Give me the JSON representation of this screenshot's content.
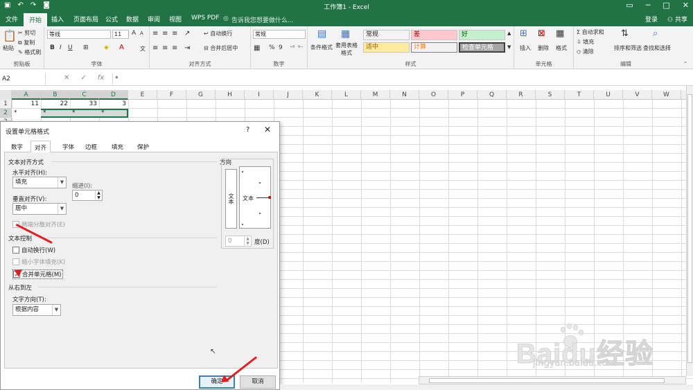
{
  "titlebar": {
    "title": "工作簿1 - Excel",
    "undo_icon": "undo-icon",
    "redo_icon": "redo-icon",
    "camera_icon": "camera-icon"
  },
  "tabs": [
    {
      "label": "文件"
    },
    {
      "label": "开始"
    },
    {
      "label": "插入"
    },
    {
      "label": "页面布局"
    },
    {
      "label": "公式"
    },
    {
      "label": "数据"
    },
    {
      "label": "审阅"
    },
    {
      "label": "视图"
    },
    {
      "label": "WPS PDF"
    }
  ],
  "search_hint": "告诉我您想要做什么...",
  "account": {
    "login": "登录",
    "share": "共享"
  },
  "ribbon": {
    "clipboard": {
      "paste": "粘贴",
      "cut": "剪切",
      "copy": "复制",
      "format_painter": "格式刷",
      "label": "剪贴板"
    },
    "font": {
      "name": "等线",
      "size": "11",
      "label": "字体",
      "bold": "B",
      "italic": "I",
      "underline": "U",
      "grow": "A",
      "shrink": "A"
    },
    "alignment": {
      "wrap": "自动换行",
      "merge": "合并后居中",
      "label": "对齐方式"
    },
    "number": {
      "format": "常规",
      "label": "数字",
      "percent": "%",
      "comma": "9"
    },
    "styles": {
      "conditional": "条件格式",
      "table": "套用表格格式",
      "cells": [
        {
          "label": "常规",
          "color": "#ffffff"
        },
        {
          "label": "差",
          "color": "#ffc7ce"
        },
        {
          "label": "好",
          "color": "#c6efce"
        },
        {
          "label": "适中",
          "color": "#ffeb9c"
        },
        {
          "label": "计算",
          "color": "#f2f2f2"
        },
        {
          "label": "检查单元格",
          "color": "#a5a5a5"
        }
      ],
      "label": "样式"
    },
    "cells_group": {
      "insert": "插入",
      "delete": "删除",
      "format": "格式",
      "label": "单元格"
    },
    "editing": {
      "autosum": "自动求和",
      "fill": "填充",
      "clear": "清除",
      "sort": "排序和筛选",
      "find": "查找和选择",
      "label": "编辑"
    }
  },
  "formula": {
    "namebox": "A2",
    "fx": "fx",
    "content": "*"
  },
  "columns": [
    "A",
    "B",
    "C",
    "D",
    "E",
    "F",
    "G",
    "H",
    "I",
    "J",
    "K",
    "L",
    "M",
    "N",
    "O",
    "P",
    "Q",
    "R",
    "S",
    "T",
    "U",
    "V",
    "W"
  ],
  "rows": [
    {
      "num": "1",
      "cells": [
        "11",
        "22",
        "33",
        "3"
      ]
    },
    {
      "num": "2",
      "cells": [
        "*",
        "*",
        "*",
        "*"
      ]
    },
    {
      "num": "3",
      "cells": [
        "",
        "",
        "",
        ""
      ]
    }
  ],
  "dialog": {
    "title": "设置单元格格式",
    "help": "?",
    "close": "✕",
    "tabs": [
      "数字",
      "对齐",
      "字体",
      "边框",
      "填充",
      "保护"
    ],
    "text_align_section": "文本对齐方式",
    "h_align_label": "水平对齐(H):",
    "h_align_value": "填充",
    "indent_label": "缩进(I):",
    "indent_value": "0",
    "v_align_label": "垂直对齐(V):",
    "v_align_value": "居中",
    "justify_distributed": "两端分散对齐(E)",
    "text_control_section": "文本控制",
    "wrap_text": "自动换行(W)",
    "shrink_to_fit": "缩小字体填充(K)",
    "merge_cells": "合并单元格(M)",
    "rtl_section": "从右到左",
    "text_direction_label": "文字方向(T):",
    "text_direction_value": "根据内容",
    "orientation_label": "方向",
    "vertical_text": "文本",
    "dial_text": "文本",
    "degrees_value": "0",
    "degrees_label": "度(D)",
    "ok": "确定",
    "cancel": "取消"
  },
  "watermark": {
    "brand": "Baidu经验",
    "url": "jingyan.baidu.com"
  }
}
